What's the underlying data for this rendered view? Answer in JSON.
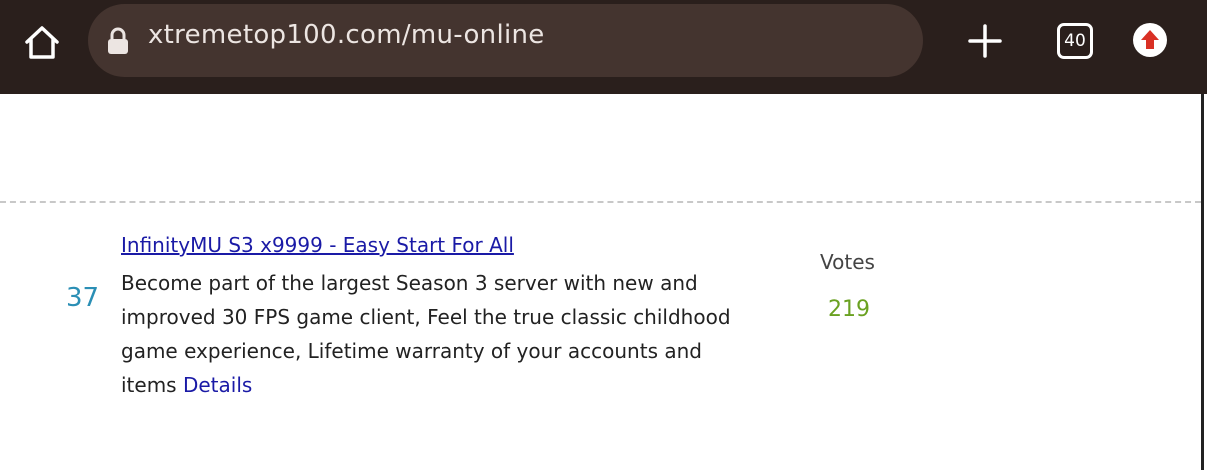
{
  "browser": {
    "url": "xtremetop100.com/mu-online",
    "tab_count": "40",
    "icons": {
      "home": "home-icon",
      "lock": "lock-icon",
      "new_tab": "plus-icon",
      "tabs": "tab-switcher-icon",
      "update": "upload-arrow-icon"
    },
    "colors": {
      "toolbar": "#2a1f1c",
      "urlbar": "#44342f",
      "update_arrow": "#d93025"
    }
  },
  "listing": {
    "rank": "37",
    "title": "InfinityMU S3 x9999 - Easy Start For All",
    "description": "Become part of the largest Season 3 server with new and improved 30 FPS game client, Feel the true classic childhood game experience, Lifetime warranty of your accounts and items",
    "details_label": "Details",
    "votes_label": "Votes",
    "votes_count": "219",
    "colors": {
      "rank": "#2b8fb5",
      "link": "#1a1aa6",
      "votes_count": "#6aa121"
    }
  }
}
